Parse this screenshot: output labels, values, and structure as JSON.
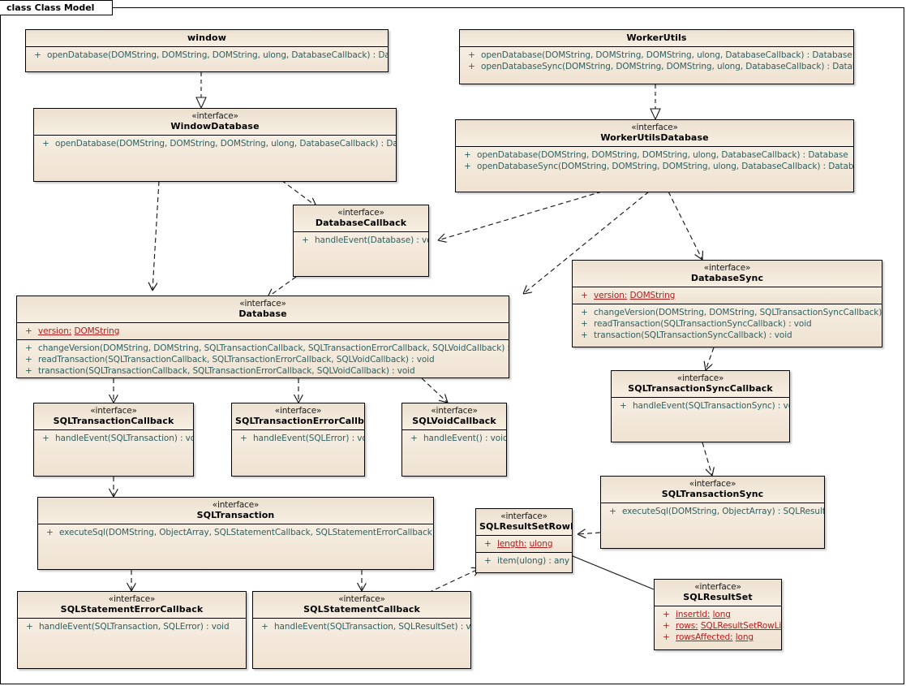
{
  "diagram": {
    "tab_label": "class Class Model",
    "type": "uml-class-diagram",
    "colors": {
      "class_fill": "#f2e5d4",
      "header_fill": "#ece0d0",
      "border": "#000000",
      "operation_text": "#2f6060",
      "attribute_text": "#b02020",
      "canvas": "#ffffff"
    }
  },
  "classes": [
    {
      "id": "window",
      "stereotype": "",
      "name": "window",
      "attributes": [],
      "operations": [
        {
          "visibility": "+",
          "text": "openDatabase(DOMString, DOMString, DOMString, ulong, DatabaseCallback) : Database"
        }
      ]
    },
    {
      "id": "workerutils",
      "stereotype": "",
      "name": "WorkerUtils",
      "attributes": [],
      "operations": [
        {
          "visibility": "+",
          "text": "openDatabase(DOMString, DOMString, DOMString, ulong, DatabaseCallback) : Database"
        },
        {
          "visibility": "+",
          "text": "openDatabaseSync(DOMString, DOMString, DOMString, ulong, DatabaseCallback) : DatabaseSync"
        }
      ]
    },
    {
      "id": "windowdatabase",
      "stereotype": "«interface»",
      "name": "WindowDatabase",
      "attributes": [],
      "operations": [
        {
          "visibility": "+",
          "text": "openDatabase(DOMString, DOMString, DOMString, ulong, DatabaseCallback) : Database"
        }
      ]
    },
    {
      "id": "workerutilsdatabase",
      "stereotype": "«interface»",
      "name": "WorkerUtilsDatabase",
      "attributes": [],
      "operations": [
        {
          "visibility": "+",
          "text": "openDatabase(DOMString, DOMString, DOMString, ulong, DatabaseCallback) : Database"
        },
        {
          "visibility": "+",
          "text": "openDatabaseSync(DOMString, DOMString, DOMString, ulong, DatabaseCallback) : DatabaseSync"
        }
      ]
    },
    {
      "id": "databasecallback",
      "stereotype": "«interface»",
      "name": "DatabaseCallback",
      "attributes": [],
      "operations": [
        {
          "visibility": "+",
          "text": "handleEvent(Database) : void"
        }
      ]
    },
    {
      "id": "database",
      "stereotype": "«interface»",
      "name": "Database",
      "attributes": [
        {
          "visibility": "+",
          "name": "version:",
          "type": "DOMString"
        }
      ],
      "operations": [
        {
          "visibility": "+",
          "text": "changeVersion(DOMString, DOMString, SQLTransactionCallback, SQLTransactionErrorCallback, SQLVoidCallback) : void"
        },
        {
          "visibility": "+",
          "text": "readTransaction(SQLTransactionCallback, SQLTransactionErrorCallback, SQLVoidCallback) : void"
        },
        {
          "visibility": "+",
          "text": "transaction(SQLTransactionCallback, SQLTransactionErrorCallback, SQLVoidCallback) : void"
        }
      ]
    },
    {
      "id": "databasesync",
      "stereotype": "«interface»",
      "name": "DatabaseSync",
      "attributes": [
        {
          "visibility": "+",
          "name": "version:",
          "type": "DOMString"
        }
      ],
      "operations": [
        {
          "visibility": "+",
          "text": "changeVersion(DOMString, DOMString, SQLTransactionSyncCallback) : void"
        },
        {
          "visibility": "+",
          "text": "readTransaction(SQLTransactionSyncCallback) : void"
        },
        {
          "visibility": "+",
          "text": "transaction(SQLTransactionSyncCallback) : void"
        }
      ]
    },
    {
      "id": "sqltransactioncallback",
      "stereotype": "«interface»",
      "name": "SQLTransactionCallback",
      "attributes": [],
      "operations": [
        {
          "visibility": "+",
          "text": "handleEvent(SQLTransaction) : void"
        }
      ]
    },
    {
      "id": "sqltransactionerrorcallback",
      "stereotype": "«interface»",
      "name": "SQLTransactionErrorCallback",
      "attributes": [],
      "operations": [
        {
          "visibility": "+",
          "text": "handleEvent(SQLError) : void"
        }
      ]
    },
    {
      "id": "sqlvoidcallback",
      "stereotype": "«interface»",
      "name": "SQLVoidCallback",
      "attributes": [],
      "operations": [
        {
          "visibility": "+",
          "text": "handleEvent() : void"
        }
      ]
    },
    {
      "id": "sqltransactionsynccallback",
      "stereotype": "«interface»",
      "name": "SQLTransactionSyncCallback",
      "attributes": [],
      "operations": [
        {
          "visibility": "+",
          "text": "handleEvent(SQLTransactionSync) : void"
        }
      ]
    },
    {
      "id": "sqltransaction",
      "stereotype": "«interface»",
      "name": "SQLTransaction",
      "attributes": [],
      "operations": [
        {
          "visibility": "+",
          "text": "executeSql(DOMString, ObjectArray, SQLStatementCallback, SQLStatementErrorCallback) : void"
        }
      ]
    },
    {
      "id": "sqltransactionsync",
      "stereotype": "«interface»",
      "name": "SQLTransactionSync",
      "attributes": [],
      "operations": [
        {
          "visibility": "+",
          "text": "executeSql(DOMString, ObjectArray) : SQLResultSet"
        }
      ]
    },
    {
      "id": "sqlresultsetrowlist",
      "stereotype": "«interface»",
      "name": "SQLResultSetRowList",
      "attributes": [
        {
          "visibility": "+",
          "name": "length:",
          "type": "ulong"
        }
      ],
      "operations": [
        {
          "visibility": "+",
          "text": "item(ulong) : any"
        }
      ]
    },
    {
      "id": "sqlresultset",
      "stereotype": "«interface»",
      "name": "SQLResultSet",
      "attributes": [
        {
          "visibility": "+",
          "name": "insertId:",
          "type": "long"
        },
        {
          "visibility": "+",
          "name": "rows:",
          "type": "SQLResultSetRowList"
        },
        {
          "visibility": "+",
          "name": "rowsAffected:",
          "type": "long"
        }
      ],
      "operations": []
    },
    {
      "id": "sqlstatementerrorcallback",
      "stereotype": "«interface»",
      "name": "SQLStatementErrorCallback",
      "attributes": [],
      "operations": [
        {
          "visibility": "+",
          "text": "handleEvent(SQLTransaction, SQLError) : void"
        }
      ]
    },
    {
      "id": "sqlstatementcallback",
      "stereotype": "«interface»",
      "name": "SQLStatementCallback",
      "attributes": [],
      "operations": [
        {
          "visibility": "+",
          "text": "handleEvent(SQLTransaction, SQLResultSet) : void"
        }
      ]
    }
  ],
  "relationships": [
    {
      "kind": "realization",
      "from": "window",
      "to": "windowdatabase"
    },
    {
      "kind": "realization",
      "from": "workerutils",
      "to": "workerutilsdatabase"
    },
    {
      "kind": "dependency",
      "from": "windowdatabase",
      "to": "database"
    },
    {
      "kind": "dependency",
      "from": "windowdatabase",
      "to": "databasecallback"
    },
    {
      "kind": "dependency",
      "from": "workerutilsdatabase",
      "to": "databasecallback"
    },
    {
      "kind": "dependency",
      "from": "workerutilsdatabase",
      "to": "database"
    },
    {
      "kind": "dependency",
      "from": "workerutilsdatabase",
      "to": "databasesync"
    },
    {
      "kind": "dependency",
      "from": "databasecallback",
      "to": "database"
    },
    {
      "kind": "dependency",
      "from": "database",
      "to": "sqltransactioncallback"
    },
    {
      "kind": "dependency",
      "from": "database",
      "to": "sqltransactionerrorcallback"
    },
    {
      "kind": "dependency",
      "from": "database",
      "to": "sqlvoidcallback"
    },
    {
      "kind": "dependency",
      "from": "databasesync",
      "to": "sqltransactionsynccallback"
    },
    {
      "kind": "dependency",
      "from": "sqltransactionsynccallback",
      "to": "sqltransactionsync"
    },
    {
      "kind": "dependency",
      "from": "sqltransactioncallback",
      "to": "sqltransaction"
    },
    {
      "kind": "dependency",
      "from": "sqltransaction",
      "to": "sqlstatementerrorcallback"
    },
    {
      "kind": "dependency",
      "from": "sqltransaction",
      "to": "sqlstatementcallback"
    },
    {
      "kind": "dependency",
      "from": "sqlstatementcallback",
      "to": "sqlresultsetrowlist"
    },
    {
      "kind": "dependency",
      "from": "sqltransactionsync",
      "to": "sqlresultsetrowlist"
    },
    {
      "kind": "aggregation",
      "from": "sqlresultset",
      "to": "sqlresultsetrowlist"
    }
  ]
}
